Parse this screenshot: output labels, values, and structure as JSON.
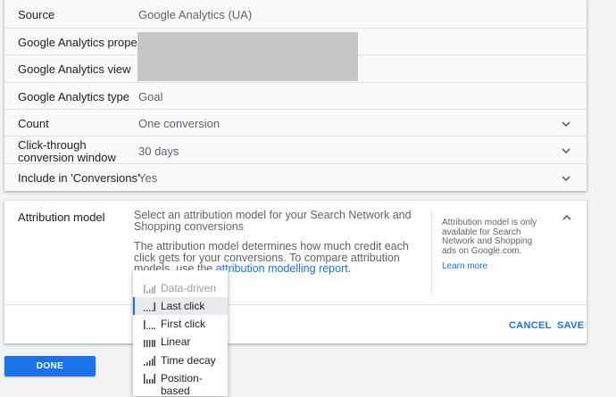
{
  "settings": {
    "rows": [
      {
        "label": "Source",
        "value": "Google Analytics (UA)"
      },
      {
        "label": "Google Analytics property",
        "value": ""
      },
      {
        "label": "Google Analytics view",
        "value": ""
      },
      {
        "label": "Google Analytics type",
        "value": "Goal"
      },
      {
        "label": "Count",
        "value": "One conversion"
      },
      {
        "label": "Click-through conversion window",
        "value": "30 days"
      },
      {
        "label": "Include in 'Conversions'",
        "value": "Yes"
      }
    ]
  },
  "attribution": {
    "label": "Attribution model",
    "desc_line1": "Select an attribution model for your Search Network and Shopping conversions",
    "desc_line2_pre": "The attribution model determines how much credit each click gets for your conversions. To compare attribution models, use the ",
    "desc_link": "attribution modelling report",
    "desc_line2_post": ".",
    "side_note": "Attribution model is only available for Search Network and Shopping ads on Google.com.",
    "learn_more": "Learn more",
    "cancel": "CANCEL",
    "save": "SAVE"
  },
  "dropdown": {
    "options": [
      {
        "label": "Data-driven",
        "icon": "data-driven-icon",
        "state": "disabled"
      },
      {
        "label": "Last click",
        "icon": "last-click-icon",
        "state": "selected"
      },
      {
        "label": "First click",
        "icon": "first-click-icon",
        "state": "normal"
      },
      {
        "label": "Linear",
        "icon": "linear-icon",
        "state": "normal"
      },
      {
        "label": "Time decay",
        "icon": "time-decay-icon",
        "state": "normal"
      },
      {
        "label": "Position-based",
        "icon": "position-based-icon",
        "state": "normal"
      }
    ]
  },
  "done": "DONE",
  "colors": {
    "accent": "#1a73e8",
    "redaction": "#c6c6c6"
  }
}
